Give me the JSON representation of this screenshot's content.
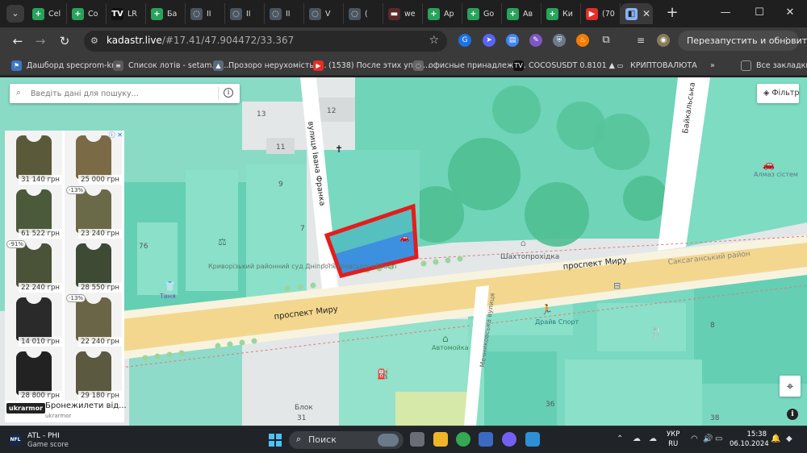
{
  "browser": {
    "tabs": [
      {
        "label": "Cel",
        "icon": "plus-icon",
        "color": "#27a35a"
      },
      {
        "label": "Co",
        "icon": "plus-icon",
        "color": "#27a35a"
      },
      {
        "label": "LR",
        "icon": "tradingview-icon",
        "color": "#111111"
      },
      {
        "label": "Ба",
        "icon": "plus-icon",
        "color": "#27a35a"
      },
      {
        "label": "II",
        "icon": "globe-icon",
        "color": "#4a5560"
      },
      {
        "label": "II",
        "icon": "globe-icon",
        "color": "#4a5560"
      },
      {
        "label": "II",
        "icon": "globe-icon",
        "color": "#4a5560"
      },
      {
        "label": "V",
        "icon": "globe-icon",
        "color": "#4a5560"
      },
      {
        "label": "(",
        "icon": "globe-icon",
        "color": "#4a5560"
      },
      {
        "label": "we",
        "icon": "web-icon",
        "color": "#5a2a2a"
      },
      {
        "label": "Ар",
        "icon": "plus-icon",
        "color": "#27a35a"
      },
      {
        "label": "Go",
        "icon": "plus-icon",
        "color": "#27a35a"
      },
      {
        "label": "Ав",
        "icon": "plus-icon",
        "color": "#27a35a"
      },
      {
        "label": "Ки",
        "icon": "plus-icon",
        "color": "#27a35a"
      },
      {
        "label": "(70",
        "icon": "youtube-icon",
        "color": "#e52d27"
      }
    ],
    "active_tab": {
      "icon": "map-icon",
      "close": "✕"
    },
    "newtab": "+",
    "window": {
      "minimize": "—",
      "maximize": "☐",
      "close": "✕"
    },
    "url": {
      "host": "kadastr.live",
      "path": "/#17.41/47.904472/33.367"
    },
    "relaunch_label": "Перезапустить и обновить",
    "bookmarks": [
      {
        "label": "Дашборд specprom-kr...",
        "icon": "flag-icon",
        "color": "#3a78c4"
      },
      {
        "label": "Список лотів - setam.ne...",
        "icon": "list-icon",
        "color": "#5a5a5a"
      },
      {
        "label": "Прозоро нерухомість -...",
        "icon": "triangle-icon",
        "color": "#5b6b7b"
      },
      {
        "label": "(1538) После этих упра...",
        "icon": "youtube-icon",
        "color": "#e52d27"
      },
      {
        "label": "офисные принадлежн...",
        "icon": "globe-icon",
        "color": "#666666"
      },
      {
        "label": "COCOSUSDT 0.8101 ▲...",
        "icon": "tradingview-icon",
        "color": "#111111"
      },
      {
        "label": "КРИПТОВАЛЮТА",
        "icon": "folder-icon",
        "color": "#3a3a3a"
      }
    ],
    "all_bookmarks": "Все закладки"
  },
  "map": {
    "search_placeholder": "Введіть дані для пошуку...",
    "filter_label": "Фільтр",
    "labels": {
      "street_franko": "вулиця Івана Франка",
      "street_baikalska": "Байкальська",
      "avenue_1": "проспект Миру",
      "avenue_2": "проспект Миру",
      "shakhto": "Шахтопрохідка",
      "saksahan": "Саксаганський район",
      "court": "Криворізький районний суд Дніпропетровської області",
      "tanya": "Таня",
      "almaz": "Алмаз сістем",
      "avtomoika": "Автомойка",
      "drive": "Драйв Спорт",
      "block": "Блок",
      "street_vert": "Мечниковська вулиця",
      "n13": "13",
      "n12": "12",
      "n11": "11",
      "n9": "9",
      "n7": "7",
      "n76": "76",
      "n8": "8",
      "n36": "36",
      "n31": "31",
      "n38": "38"
    }
  },
  "ad": {
    "items": [
      {
        "price": "31 140 грн",
        "disc": "",
        "color": "#5a5a3a"
      },
      {
        "price": "25 000 грн",
        "disc": "",
        "color": "#7a6a45"
      },
      {
        "price": "61 522 грн",
        "disc": "",
        "color": "#4a5a3a"
      },
      {
        "price": "23 240 грн",
        "disc": "-13%",
        "color": "#6b6a48"
      },
      {
        "price": "22 240 грн",
        "disc": "-91%",
        "color": "#4a5238"
      },
      {
        "price": "28 550 грн",
        "disc": "",
        "color": "#3f4a34"
      },
      {
        "price": "14 010 грн",
        "disc": "",
        "color": "#2a2a2a"
      },
      {
        "price": "22 240 грн",
        "disc": "-13%",
        "color": "#6b6548"
      },
      {
        "price": "28 800 грн",
        "disc": "",
        "color": "#222222"
      },
      {
        "price": "29 180 грн",
        "disc": "",
        "color": "#5b5a40"
      }
    ],
    "brand": "ukrarmor",
    "headline": "Бронежилети від...",
    "domain": "ukrarmor"
  },
  "taskbar": {
    "news_title": "ATL - PHI",
    "news_sub": "Game score",
    "search_label": "Поиск",
    "lang_1": "УКР",
    "lang_2": "RU",
    "time": "15:38",
    "date": "06.10.2024"
  }
}
